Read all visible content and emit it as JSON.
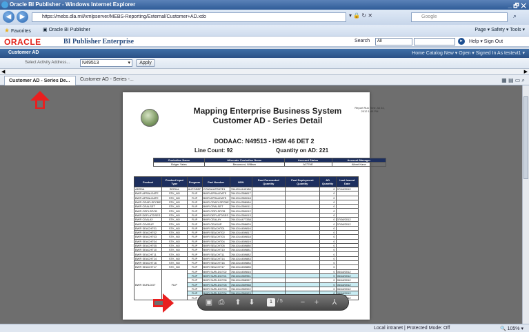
{
  "window": {
    "title": "Oracle BI Publisher - Windows Internet Explorer",
    "controls": "_ 🗗 ✕"
  },
  "browser": {
    "url": "https://mebs.dla.mil/xmlpserver/MEBS-Reporting/External/Customer+AD.xdo",
    "search_placeholder": "Google",
    "favorites_label": "Favorites",
    "tab_label": "Oracle BI Publisher",
    "command_bar": "Page ▾  Safety ▾  Tools ▾"
  },
  "bip": {
    "brand": "ORACLE",
    "product": "BI Publisher Enterprise",
    "search_label": "Search",
    "search_value": "All",
    "right_links": "Help ▾   Sign Out"
  },
  "page": {
    "title": "Customer AD",
    "links": "Home  Catalog  New ▾  Open ▾  Signed In As  testevt1 ▾"
  },
  "params": {
    "label": "Select Activity Address...",
    "value": "N49513",
    "apply": "Apply"
  },
  "tabs": {
    "active": "Customer AD - Series De...",
    "other": "Customer AD - Series -..."
  },
  "report": {
    "title_line1": "Mapping Enterprise Business System",
    "title_line2": "Customer AD - Series Detail",
    "run_date": "Report Run Time Jul 24, 2012 1:45 PM",
    "dodaac": "DODAAC: N49513 - HSM 46 DET 2",
    "line_count": "Line Count: 92",
    "quantity": "Quantity on AD: 221",
    "info_headers": [
      "Custodian Name",
      "Alternate Custodian Name",
      "Account Status",
      "Account Manager"
    ],
    "info_values": [
      "Bulger Yates",
      "Beaumont, William",
      "ACTIVE",
      "Albert Kane"
    ],
    "headers": [
      "Product",
      "Product Input Type",
      "Program",
      "Part Number",
      "NSN",
      "Past Forecasted Quantity",
      "Past Deployment Quantity",
      "AD Quantity",
      "Last Issued Date"
    ],
    "rows": [
      [
        "ADR5A",
        "SERIAL",
        "AUTODEF",
        "CONVAUFRATE1",
        "7644014449186",
        "",
        "",
        "0",
        "07/18/2012"
      ],
      [
        "BWR APRALDATE",
        "STK_NO",
        "FLIP",
        "BWR APRALDATE",
        "7641014358817",
        "",
        "",
        "0",
        ""
      ],
      [
        "BWR APRALDATE",
        "STK_NO",
        "FLIP",
        "BWR APRALDATE",
        "7641014359018",
        "",
        "",
        "0",
        ""
      ],
      [
        "BWR CRAFLSPCBE",
        "STK_NO",
        "FLIP",
        "BWR CRAFLSPCBE",
        "7641014358984",
        "",
        "",
        "0",
        ""
      ],
      [
        "BWR CRALSET",
        "STK_NO",
        "FLIP",
        "BWR CRALSET",
        "7641014359011",
        "",
        "",
        "0",
        ""
      ],
      [
        "BWR CRFLSPCB",
        "STK_NO",
        "FLIP",
        "BWR CRFLSPCB",
        "7641014359012",
        "",
        "",
        "0",
        ""
      ],
      [
        "BWR DEFLATDSES",
        "STK_NO",
        "FLIP",
        "BWR DEFLATDSES",
        "7641014359013",
        "",
        "",
        "0",
        ""
      ],
      [
        "BWR CEALAY",
        "STK_NO",
        "FLIP",
        "BWR CEALAY",
        "7641014477338",
        "",
        "",
        "0",
        "07/08/2012"
      ],
      [
        "BWR CEASUP",
        "STK_NO",
        "FLIP",
        "BWR CEASUP",
        "7641014358829",
        "",
        "",
        "0",
        "07/08/2012"
      ],
      [
        "BWR SEACHT01",
        "STK_NO",
        "FLIP",
        "BWR SEACHT01",
        "7641014459816",
        "",
        "",
        "0",
        ""
      ],
      [
        "BWR SEACHT02",
        "STK_NO",
        "FLIP",
        "BWR SEACHT02",
        "7641014459817",
        "",
        "",
        "0",
        ""
      ],
      [
        "BWR SEACHT03",
        "STK_NO",
        "FLIP",
        "BWR SEACHT03",
        "7641014459818",
        "",
        "",
        "0",
        ""
      ],
      [
        "BWR SEACHT04",
        "STK_NO",
        "FLIP",
        "BWR SEACHT04",
        "7641014459819",
        "",
        "",
        "0",
        ""
      ],
      [
        "BWR SEACHT05",
        "STK_NO",
        "FLIP",
        "BWR SEACHT05",
        "7641014459880",
        "",
        "",
        "0",
        ""
      ],
      [
        "BWR SEACHT10",
        "STK_NO",
        "FLIP",
        "BWR SEACHT10",
        "7641014459881",
        "",
        "",
        "0",
        ""
      ],
      [
        "BWR SEACHT11",
        "STK_NO",
        "FLIP",
        "BWR SEACHT11",
        "7641014459882",
        "",
        "",
        "0",
        ""
      ],
      [
        "BWR SEACHT14",
        "STK_NO",
        "FLIP",
        "BWR SEACHT14",
        "7641014459883",
        "",
        "",
        "0",
        ""
      ],
      [
        "BWR SEACHT16",
        "STK_NO",
        "FLIP",
        "BWR SEACHT16",
        "7641014459884",
        "",
        "",
        "0",
        ""
      ],
      [
        "BWR SEACHT17",
        "STK_NO",
        "FLIP",
        "BWR SEACHT17",
        "7641014459885",
        "",
        "",
        "0",
        ""
      ]
    ],
    "group_product": "BWR SURLDGT",
    "group_program": "FLIP",
    "group_rows": [
      [
        "FLIP",
        "BWR SURLDGT02",
        "7641014459815",
        "0",
        "06/18/2012"
      ],
      [
        "FLIP",
        "BWR SURLDGT01",
        "7641014359951",
        "0",
        "06/18/2012"
      ],
      [
        "FLIP",
        "BWR SURLDGT06",
        "7641014358957",
        "0",
        "06/18/2012"
      ],
      [
        "FLIP",
        "BWR SURLDGT05",
        "7641014359968",
        "0",
        "06/18/2012"
      ],
      [
        "FLIP",
        "BWR SURLDGT03",
        "7641014359922",
        "0",
        "06/18/2012"
      ],
      [
        "FLIP",
        "BWR SURLDGT04",
        "7641014359923",
        "0",
        "06/18/2012"
      ],
      [
        "FLIP",
        "BWR SURLDGT07",
        "7641014359998",
        "0",
        "06/18/2012"
      ]
    ]
  },
  "viewer": {
    "page": "1",
    "of": "/ 5"
  },
  "status": {
    "zone": "Local intranet | Protected Mode: Off",
    "zoom": "105%"
  },
  "colors": {
    "accent": "#2b5186",
    "marker": "#e81f1f"
  }
}
